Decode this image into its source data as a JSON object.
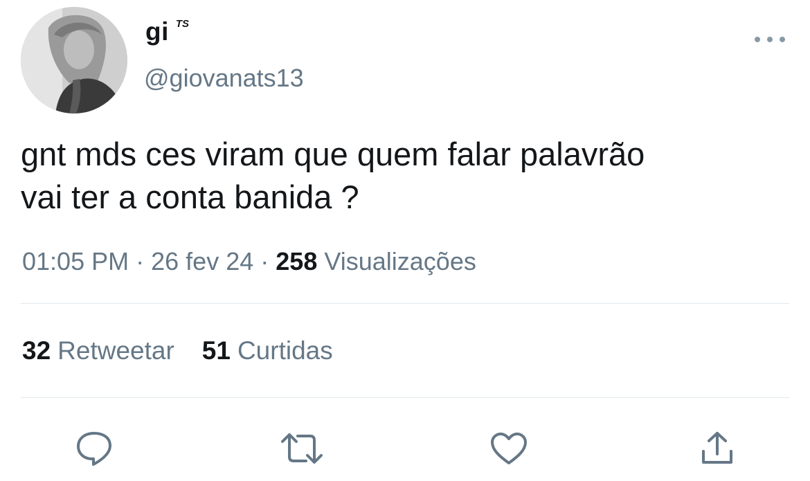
{
  "tweet": {
    "author": {
      "display_name": "gi",
      "name_badge": "TS",
      "handle": "@giovanats13"
    },
    "text_lines": [
      "gnt mds ces viram que quem falar palavrão",
      "vai ter a conta banida ?"
    ],
    "meta": {
      "time": "01:05 PM",
      "separator": "·",
      "date": "26 fev 24",
      "views_count": "258",
      "views_label": "Visualizações"
    },
    "stats": {
      "retweets_count": "32",
      "retweets_label": "Retweetar",
      "likes_count": "51",
      "likes_label": "Curtidas"
    },
    "actions": [
      "reply-icon",
      "retweet-icon",
      "like-icon",
      "share-icon"
    ]
  },
  "colors": {
    "text_primary": "#14171a",
    "text_secondary": "#657786",
    "icon": "#657786",
    "divider": "#e1e8ed"
  }
}
